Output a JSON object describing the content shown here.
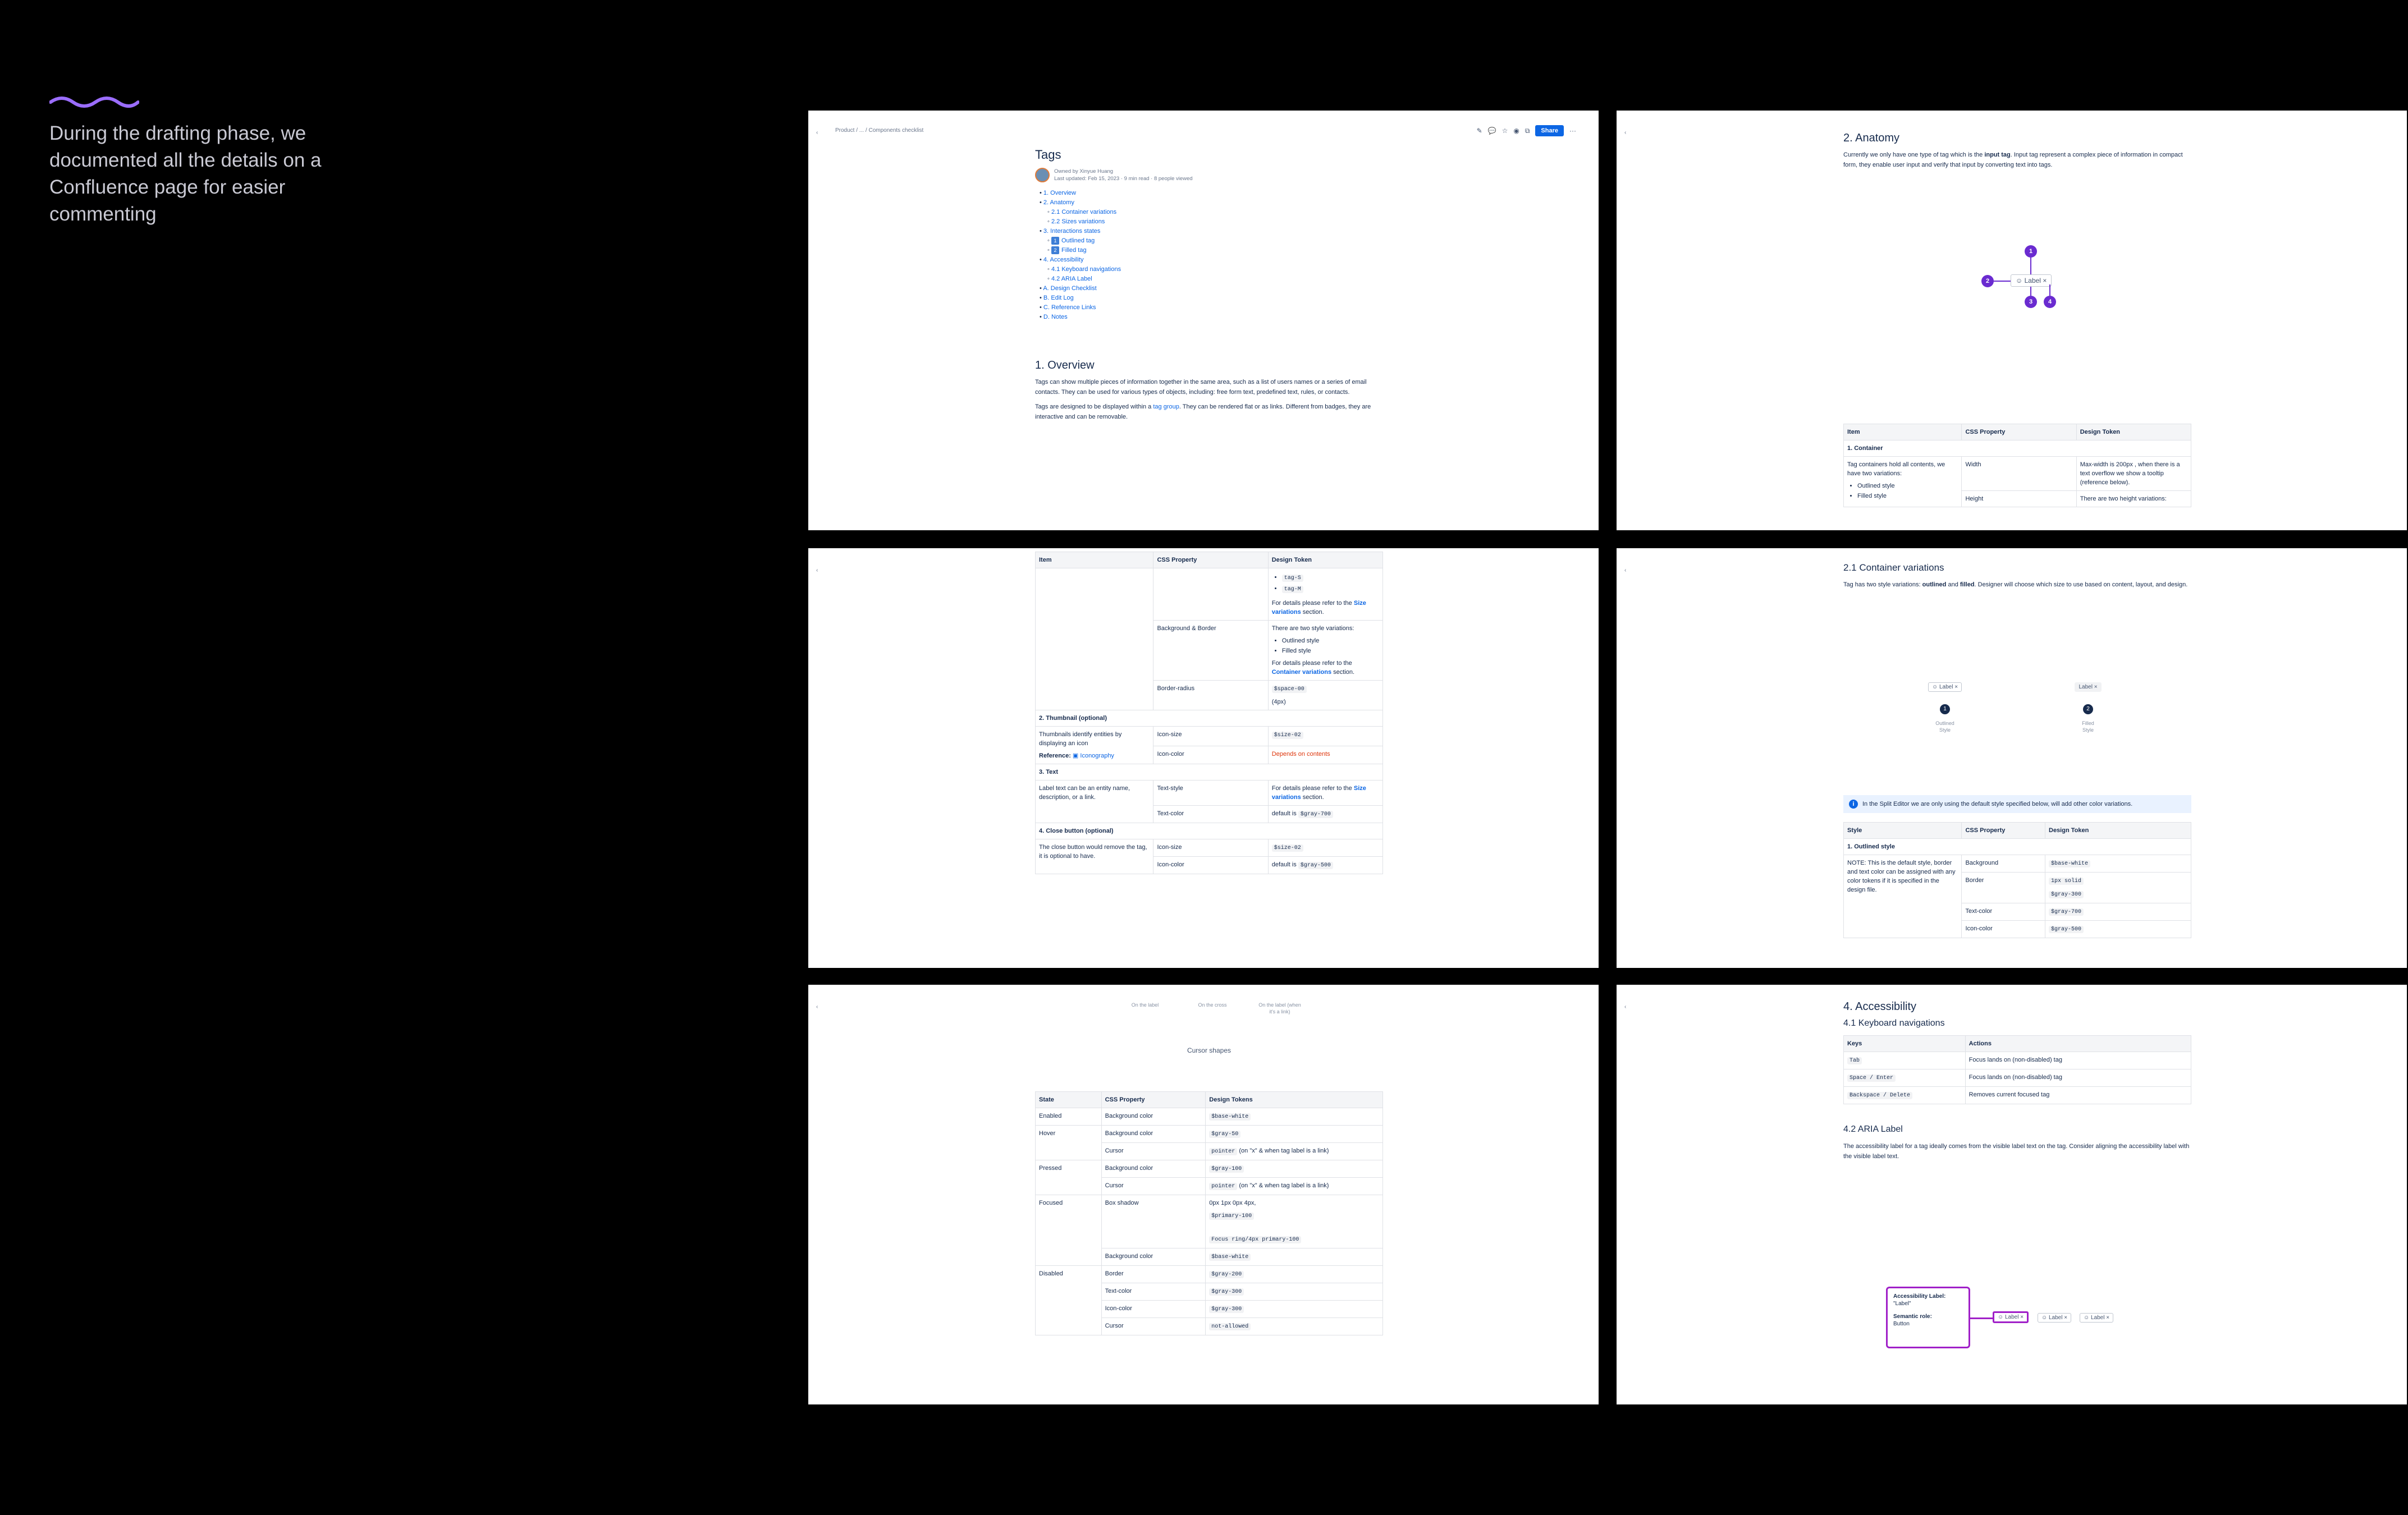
{
  "intro": {
    "text": "During the drafting phase, we documented all the details on a Confluence page for easier commenting",
    "accent": "#9b6dff"
  },
  "p1": {
    "breadcrumb": "Product  /  ...  /  Components checklist",
    "share": "Share",
    "title": "Tags",
    "owned_by": "Owned by Xinyue Huang",
    "updated": "Last updated: Feb 15, 2023 · 9 min read  ·  8 people viewed",
    "toc": [
      {
        "label": "1. Overview",
        "level": 0
      },
      {
        "label": "2. Anatomy",
        "level": 0
      },
      {
        "label": "2.1 Container variations",
        "level": 1
      },
      {
        "label": "2.2 Sizes variations",
        "level": 1
      },
      {
        "label": "3. Interactions states",
        "level": 0
      },
      {
        "label": "Outlined tag",
        "level": 1,
        "box": "1"
      },
      {
        "label": "Filled tag",
        "level": 1,
        "box": "2"
      },
      {
        "label": "4. Accessibility",
        "level": 0
      },
      {
        "label": "4.1 Keyboard navigations",
        "level": 1
      },
      {
        "label": "4.2 ARIA Label",
        "level": 1
      },
      {
        "label": "A. Design Checklist",
        "level": 0
      },
      {
        "label": "B. Edit Log",
        "level": 0
      },
      {
        "label": "C. Reference Links",
        "level": 0
      },
      {
        "label": "D. Notes",
        "level": 0
      }
    ],
    "overview_heading": "1. Overview",
    "overview_p1": "Tags can show multiple pieces of information together in the same area, such as a list of users names or a series of email contacts. They can be used for various types of objects, including: free form text, predefined text, rules, or contacts.",
    "overview_p2a": "Tags are designed to be displayed within a ",
    "overview_p2_link": "tag group",
    "overview_p2b": ". They can be rendered flat or as links. Different from badges, they are interactive and can be removable."
  },
  "p2": {
    "heading": "2. Anatomy",
    "intro_a": "Currently we only have one type of tag which is the ",
    "intro_bold": "input tag",
    "intro_b": ". Input tag represent a complex piece of information in compact form, they enable user input and verify that input by converting text into tags.",
    "chip_label": "Label",
    "markers": [
      "1",
      "2",
      "3",
      "4"
    ],
    "headers": [
      "Item",
      "CSS Property",
      "Design Token"
    ],
    "section": "1. Container",
    "row_item": "Tag containers hold all contents, we have two variations:",
    "row_list": [
      "Outlined style",
      "Filled style"
    ],
    "row_prop1": "Width",
    "row_tok1": "Max-width is 200px , when there is a text overflow we show a tooltip (reference below).",
    "row_prop2": "Height",
    "row_tok2": "There are two height variations:"
  },
  "p3": {
    "headers": [
      "Item",
      "CSS Property",
      "Design Token"
    ],
    "tok_list": [
      "tag-S",
      "tag-M"
    ],
    "refer_a": "For details please refer to the ",
    "size_var": "Size variations",
    "section_word": " section.",
    "bg_border": "Background & Border",
    "two_styles": "There are two style variations:",
    "style_list": [
      "Outlined style",
      "Filled style"
    ],
    "container_var": "Container variations",
    "border_radius": "Border-radius",
    "space": "$space-00",
    "px4": "(4px)",
    "sec2": "2. Thumbnail (optional)",
    "thumb_desc": "Thumbnails identify entities by displaying an icon",
    "reference": "Reference:",
    "iconography": "Iconography",
    "icon_size": "Icon-size",
    "size_02": "$size-02",
    "icon_color": "Icon-color",
    "depends": "Depends on contents",
    "sec3": "3. Text",
    "text_desc": "Label text can be an entity name, description, or a link.",
    "text_style": "Text-style",
    "text_color": "Text-color",
    "default_is": "default is ",
    "gray700": "$gray-700",
    "sec4": "4. Close button (optional)",
    "close_desc": "The close button would remove the tag, it is optional to have.",
    "size_02b": "$size-02",
    "gray500": "$gray-500"
  },
  "p4": {
    "heading": "2.1 Container variations",
    "intro_a": "Tag has two style variations: ",
    "b1": "outlined",
    "and": " and ",
    "b2": "filled",
    "intro_b": ". Designer will choose which size to use based on content, layout, and design.",
    "chip": "Label",
    "n1": "1",
    "n2": "2",
    "cap1": "Outlined Style",
    "cap2": "Filled Style",
    "info": "In the Split Editor we are only using the default style specified below, will add other color variations.",
    "headers": [
      "Style",
      "CSS Property",
      "Design Token"
    ],
    "section": "1. Outlined style",
    "note": "NOTE: This is the default style, border and text color can be assigned with any color tokens if it is specified in the design file.",
    "background": "Background",
    "base_white": "$base-white",
    "border": "Border",
    "solid": "1px solid",
    "gray300": "$gray-300",
    "text_color": "Text-color",
    "gray700": "$gray-700",
    "icon_color": "Icon-color",
    "gray500": "$gray-500"
  },
  "p5": {
    "captions": [
      "On the label",
      "On the cross",
      "On the label (when it's a link)"
    ],
    "cursor_shapes": "Cursor shapes",
    "headers": [
      "State",
      "CSS Property",
      "Design Tokens"
    ],
    "rows": [
      {
        "state": "Enabled",
        "prop": "Background color",
        "tok": "$base-white",
        "extra": ""
      },
      {
        "state": "Hover",
        "prop": "Background color",
        "tok": "$gray-50",
        "extra": ""
      },
      {
        "state": "",
        "prop": "Cursor",
        "tok": "pointer",
        "extra": " (on \"x\" & when tag label is a link)"
      },
      {
        "state": "Pressed",
        "prop": "Background color",
        "tok": "$gray-100",
        "extra": ""
      },
      {
        "state": "",
        "prop": "Cursor",
        "tok": "pointer",
        "extra": " (on \"x\" & when tag label is a link)"
      }
    ],
    "focused": "Focused",
    "box_shadow": "Box shadow",
    "shadow_val": "0px 1px 0px 4px,",
    "primary100": "$primary-100",
    "focus_ring": "Focus ring/4px primary-100",
    "bg_color": "Background color",
    "base_white": "$base-white",
    "disabled_rows": [
      {
        "state": "Disabled",
        "prop": "Border",
        "tok": "$gray-200"
      },
      {
        "state": "",
        "prop": "Text-color",
        "tok": "$gray-300"
      },
      {
        "state": "",
        "prop": "Icon-color",
        "tok": "$gray-300"
      },
      {
        "state": "",
        "prop": "Cursor",
        "tok": "not-allowed"
      }
    ]
  },
  "p6": {
    "heading": "4. Accessibility",
    "sub1": "4.1 Keyboard navigations",
    "headers": [
      "Keys",
      "Actions"
    ],
    "rows": [
      {
        "key": "Tab",
        "action": "Focus lands on (non-disabled) tag"
      },
      {
        "key": "Space / Enter",
        "action": "Focus lands on (non-disabled) tag"
      },
      {
        "key": "Backspace / Delete",
        "action": "Removes current focused tag"
      }
    ],
    "sub2": "4.2 ARIA Label",
    "aria_p": "The accessibility label for a tag ideally comes from the visible label text on the tag. Consider aligning the accessibility label with the visible label text.",
    "acc_label": "Accessibility Label:",
    "acc_label_val": "\"Label\"",
    "sem_role": "Semantic role:",
    "sem_role_val": "Button",
    "chips": [
      "Label",
      "Label",
      "Label"
    ]
  }
}
